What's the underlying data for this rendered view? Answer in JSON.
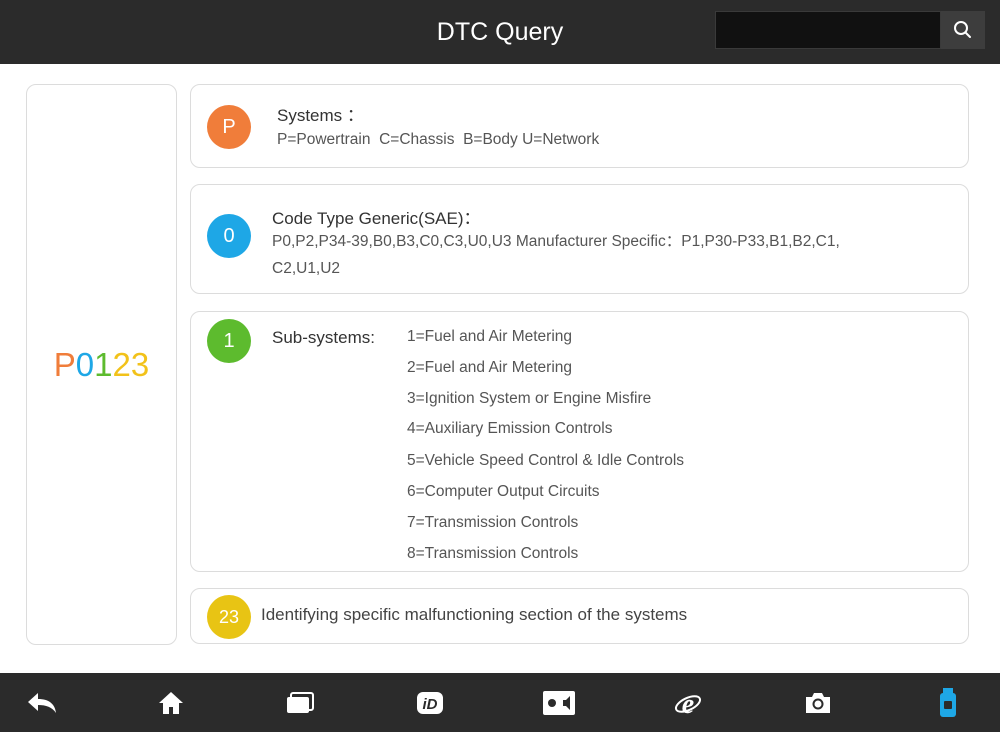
{
  "header": {
    "title": "DTC Query",
    "search_value": ""
  },
  "dtc": {
    "code_chars": [
      {
        "char": "P",
        "color": "#f07d3a"
      },
      {
        "char": "0",
        "color": "#1ea7e6"
      },
      {
        "char": "1",
        "color": "#5dbb2e"
      },
      {
        "char": "2",
        "color": "#f2c21a"
      },
      {
        "char": "3",
        "color": "#f2c21a"
      }
    ]
  },
  "sections": {
    "systems": {
      "badge": "P",
      "badge_color": "#f07d3a",
      "title": "Systems ：",
      "body": "P=Powertrain  C=Chassis  B=Body U=Network"
    },
    "code_type": {
      "badge": "0",
      "badge_color": "#1ea7e6",
      "title": "Code Type Generic(SAE)：",
      "body": "P0,P2,P34-39,B0,B3,C0,C3,U0,U3 Manufacturer Specific：P1,P30-P33,B1,B2,C1, C2,U1,U2"
    },
    "sub_systems": {
      "badge": "1",
      "badge_color": "#5dbb2e",
      "title": "Sub-systems:",
      "items": [
        "1=Fuel and Air Metering",
        "2=Fuel and Air Metering",
        "3=Ignition System or Engine Misfire",
        "4=Auxiliary Emission Controls",
        "5=Vehicle Speed Control & Idle Controls",
        "6=Computer Output Circuits",
        "7=Transmission Controls",
        "8=Transmission Controls"
      ]
    },
    "specific": {
      "badge": "23",
      "badge_color": "#e8c414",
      "body": "Identifying specific malfunctioning section of the systems"
    }
  },
  "bottom_nav": {
    "items": [
      "back-icon",
      "home-icon",
      "recent-apps-icon",
      "vci-app-icon",
      "display-settings-icon",
      "browser-icon",
      "camera-icon",
      "vci-status-icon"
    ]
  }
}
